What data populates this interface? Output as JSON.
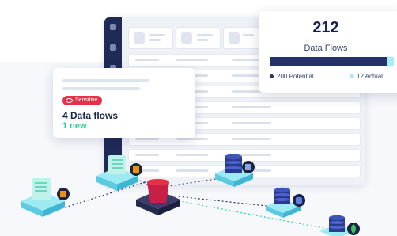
{
  "summary": {
    "count": "212",
    "label": "Data Flows",
    "potential_label": "200 Potential",
    "actual_label": "12  Actual",
    "potential_fraction": 0.943,
    "colors": {
      "potential": "#25326a",
      "actual": "#a8ecf4"
    }
  },
  "info_card": {
    "badge": "Sensitive",
    "title": "4 Data flows",
    "subtitle": "1 new",
    "colors": {
      "badge": "#e5304a",
      "subtitle": "#2ecfa0"
    }
  },
  "diagram": {
    "nodes": [
      {
        "name": "document-server-left-node",
        "icon": "document-stack-icon",
        "badge": "aws-icon"
      },
      {
        "name": "document-server-middle-node",
        "icon": "document-stack-icon",
        "badge": "aws-icon"
      },
      {
        "name": "sensitive-bucket-node",
        "icon": "bucket-icon"
      },
      {
        "name": "database-node-1",
        "icon": "database-icon",
        "badge": "server-icon"
      },
      {
        "name": "database-node-2",
        "icon": "database-icon",
        "badge": "database-badge-icon"
      },
      {
        "name": "database-node-3",
        "icon": "database-icon",
        "badge": "leaf-icon"
      }
    ]
  }
}
